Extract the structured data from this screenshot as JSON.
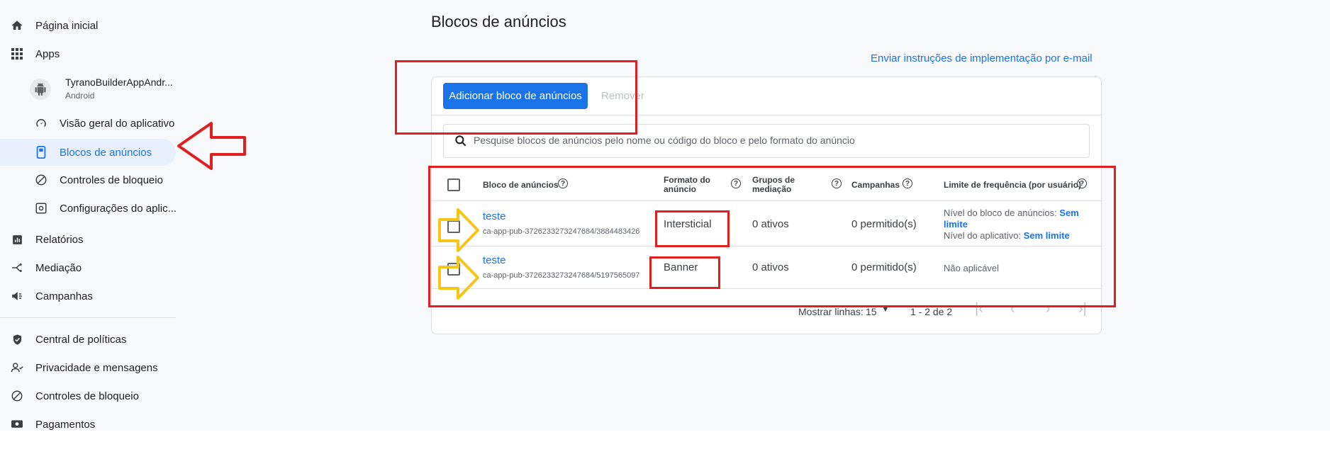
{
  "sidebar": {
    "items": [
      {
        "label": "Página inicial",
        "icon": "home-icon"
      },
      {
        "label": "Apps",
        "icon": "apps-grid-icon"
      },
      {
        "label": "TyranoBuilderAppAndr...",
        "sublabel": "Android",
        "icon": "android-icon"
      },
      {
        "label": "Visão geral do aplicativo",
        "icon": "gauge-icon"
      },
      {
        "label": "Blocos de anúncios",
        "icon": "ad-unit-icon",
        "active": true
      },
      {
        "label": "Controles de bloqueio",
        "icon": "block-icon"
      },
      {
        "label": "Configurações do aplic...",
        "icon": "settings-icon"
      },
      {
        "label": "Relatórios",
        "icon": "reports-icon"
      },
      {
        "label": "Mediação",
        "icon": "mediation-icon"
      },
      {
        "label": "Campanhas",
        "icon": "campaign-icon"
      },
      {
        "label": "Central de políticas",
        "icon": "shield-icon"
      },
      {
        "label": "Privacidade e mensagens",
        "icon": "privacy-icon"
      },
      {
        "label": "Controles de bloqueio",
        "icon": "block-icon"
      },
      {
        "label": "Pagamentos",
        "icon": "payments-icon"
      }
    ]
  },
  "main": {
    "title": "Blocos de anúncios",
    "email_link": "Enviar instruções de implementação por e-mail",
    "add_button": "Adicionar bloco de anúncios",
    "remove_button": "Remover",
    "search_placeholder": "Pesquise blocos de anúncios pelo nome ou código do bloco e pelo formato do anúncio",
    "columns": {
      "name": "Bloco de anúncios",
      "format_1": "Formato do",
      "format_2": "anúncio",
      "mediation_1": "Grupos de",
      "mediation_2": "mediação",
      "campaigns": "Campanhas",
      "frequency": "Limite de frequência (por usuário)"
    },
    "rows": [
      {
        "name": "teste",
        "code": "ca-app-pub-3726233273247684/3884483426",
        "format": "Intersticial",
        "mediation": "0 ativos",
        "campaigns": "0 permitido(s)",
        "freq_unit_label": "Nível do bloco de anúncios: ",
        "freq_unit_value_1": "Sem",
        "freq_unit_value_2": "limite",
        "freq_app_label": "Nível do aplicativo: ",
        "freq_app_value": "Sem limite"
      },
      {
        "name": "teste",
        "code": "ca-app-pub-3726233273247684/5197565097",
        "format": "Banner",
        "mediation": "0 ativos",
        "campaigns": "0 permitido(s)",
        "freq": "Não aplicável"
      }
    ],
    "footer": {
      "rows_label": "Mostrar linhas:",
      "rows_value": "15",
      "range": "1 - 2 de 2"
    }
  },
  "colors": {
    "accent": "#1a73e8",
    "annotation_red": "#e02020",
    "annotation_yellow": "#f5c518"
  }
}
